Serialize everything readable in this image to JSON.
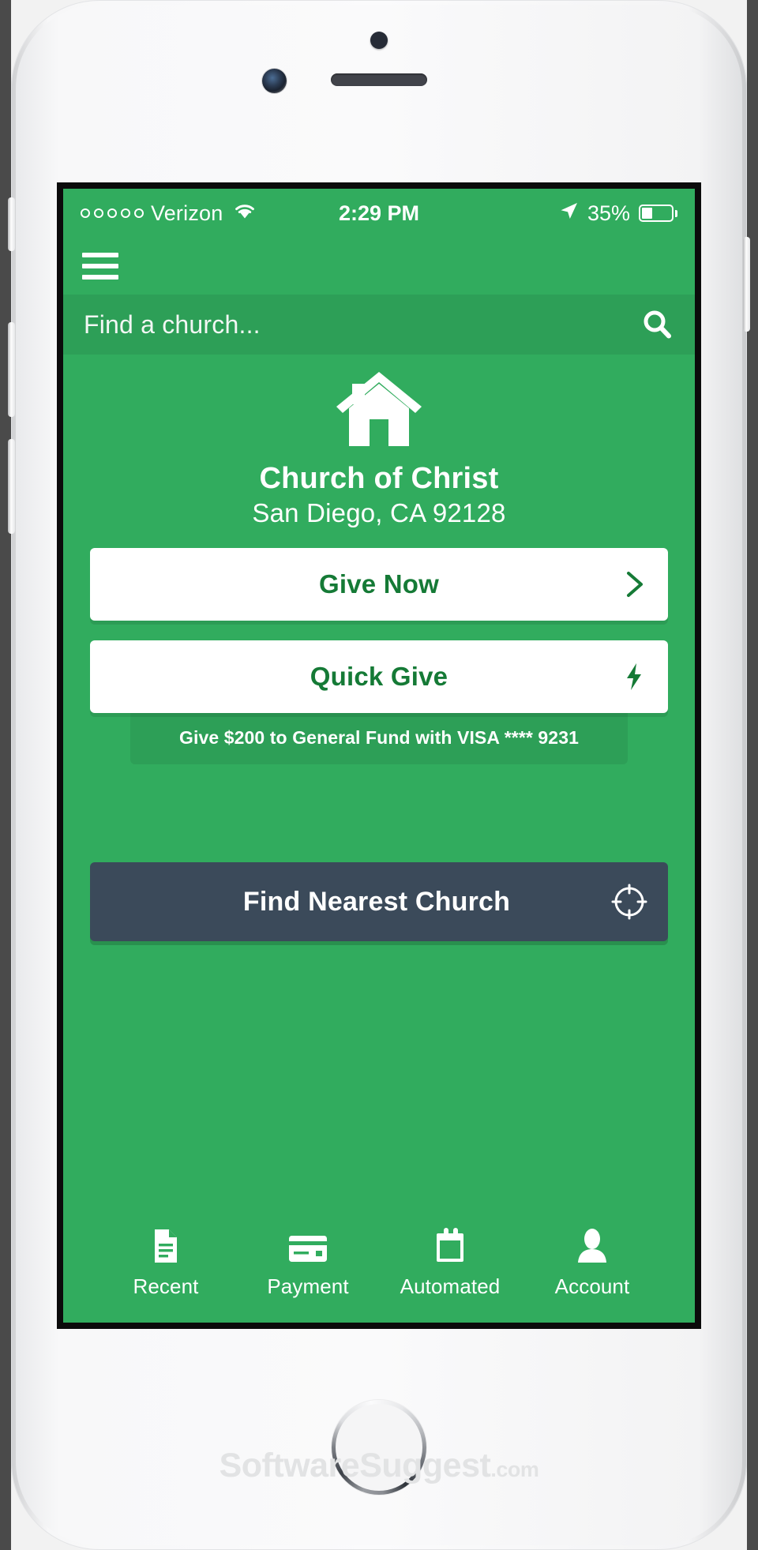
{
  "device": {
    "hardware": {
      "sensor": "proximity-sensor",
      "camera": "front-camera",
      "speaker": "earpiece-speaker",
      "home_button": "home-button"
    }
  },
  "watermark": {
    "brand": "SoftwareSuggest",
    "tld": ".com"
  },
  "status_bar": {
    "carrier": "Verizon",
    "signal_dots": 5,
    "wifi_icon": "wifi-icon",
    "time": "2:29 PM",
    "location_icon": "location-arrow-icon",
    "battery_percent": "35%",
    "battery_level": 35
  },
  "nav": {
    "menu_icon": "hamburger-menu-icon"
  },
  "search": {
    "placeholder": "Find a church...",
    "value": "",
    "icon": "search-icon"
  },
  "church": {
    "logo_icon": "house-icon",
    "name": "Church of Christ",
    "address": "San Diego, CA 92128"
  },
  "actions": {
    "give_now": {
      "label": "Give Now",
      "icon": "chevron-right-icon"
    },
    "quick_give": {
      "label": "Quick Give",
      "icon": "lightning-bolt-icon"
    },
    "quick_give_detail": "Give $200 to General Fund with VISA **** 9231",
    "find_nearest": {
      "label": "Find Nearest Church",
      "icon": "crosshair-target-icon"
    }
  },
  "tabbar": {
    "items": [
      {
        "label": "Recent",
        "icon": "document-icon"
      },
      {
        "label": "Payment",
        "icon": "credit-card-icon"
      },
      {
        "label": "Automated",
        "icon": "calendar-icon"
      },
      {
        "label": "Account",
        "icon": "person-icon"
      }
    ]
  },
  "colors": {
    "brand_green": "#31ac5e",
    "brand_green_dark": "#2d9f57",
    "text_green": "#157a36",
    "slate": "#3b4a5a",
    "white": "#ffffff"
  }
}
